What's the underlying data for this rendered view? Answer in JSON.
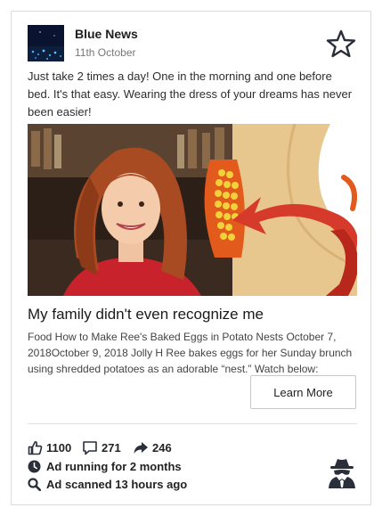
{
  "post": {
    "brand": "Blue News",
    "date": "11th October",
    "text": "Just take 2 times a day! One in the morning and one before bed. It's that easy. Wearing the dress of your dreams has never been easier!"
  },
  "ad": {
    "headline": "My family didn't even recognize me",
    "description": "Food How to Make Ree's Baked Eggs in Potato Nests October 7, 2018October 9, 2018 Jolly H Ree bakes eggs for her Sunday brunch using shredded potatoes as an adorable “nest.” Watch below:",
    "cta_label": "Learn More"
  },
  "stats": {
    "likes": "1100",
    "comments": "271",
    "shares": "246"
  },
  "meta": {
    "running": "Ad running for 2 months",
    "scanned": "Ad scanned 13 hours ago"
  },
  "icons": [
    "star-icon",
    "thumbs-up-icon",
    "comment-icon",
    "share-icon",
    "clock-icon",
    "search-icon",
    "spy-icon"
  ],
  "colors": {
    "accent_red": "#d63a2a",
    "fat_yellow": "#f2d23a",
    "skin": "#e8c78f"
  }
}
